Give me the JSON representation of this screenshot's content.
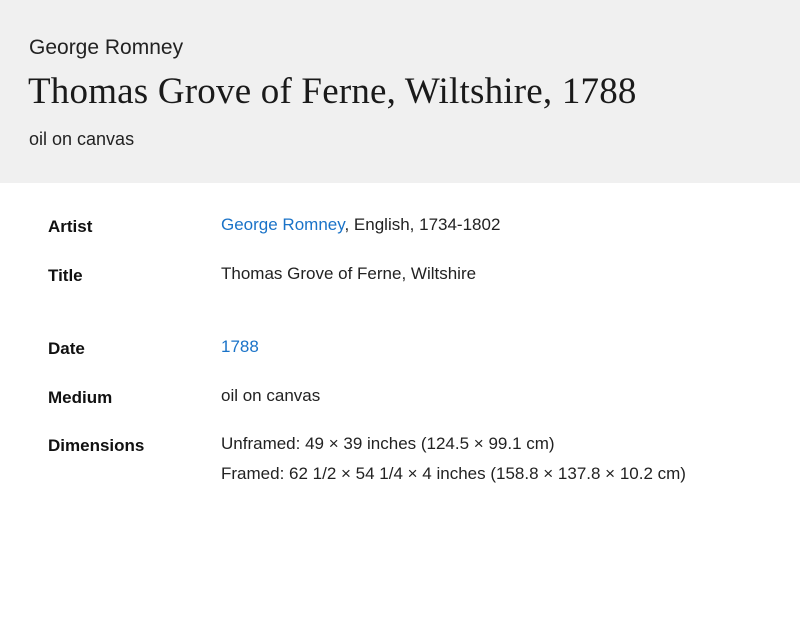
{
  "header": {
    "artist": "George Romney",
    "title": "Thomas Grove of Ferne, Wiltshire, 1788",
    "medium": "oil on canvas"
  },
  "details": {
    "artist": {
      "label": "Artist",
      "link": "George Romney",
      "suffix": ", English, 1734-1802"
    },
    "title": {
      "label": "Title",
      "value": "Thomas Grove of Ferne, Wiltshire"
    },
    "date": {
      "label": "Date",
      "link": "1788"
    },
    "medium": {
      "label": "Medium",
      "value": "oil on canvas"
    },
    "dimensions": {
      "label": "Dimensions",
      "lines": [
        "Unframed: 49 × 39 inches (124.5 × 99.1 cm)",
        "Framed: 62 1/2 × 54 1/4 × 4 inches (158.8 × 137.8 × 10.2 cm)"
      ]
    }
  },
  "colors": {
    "header_background": "#f0f0f0",
    "link": "#1a73c8",
    "text": "#222222"
  }
}
